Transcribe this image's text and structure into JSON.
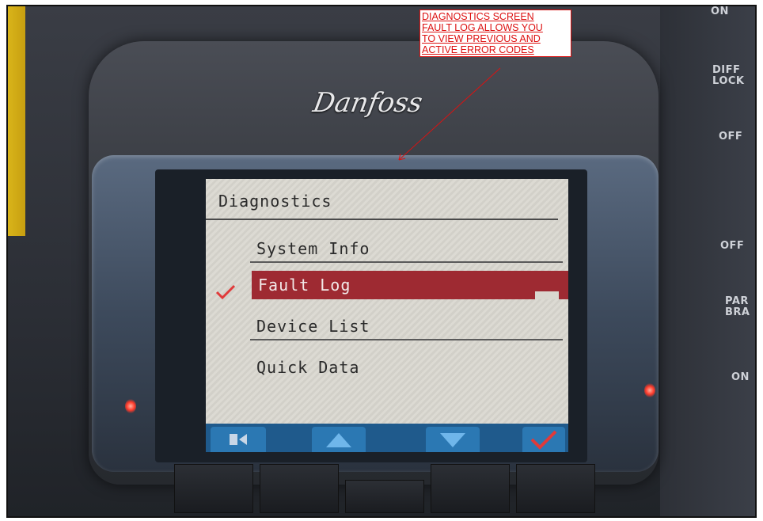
{
  "annotation": {
    "lines": [
      "DIAGNOSTICS SCREEN",
      "FAULT LOG ALLOWS YOU",
      "TO VIEW PREVIOUS AND",
      "ACTIVE ERROR CODES"
    ],
    "color": "#dd1111"
  },
  "brand": {
    "logo_text": "Danfoss"
  },
  "side_labels": {
    "on_top": "ON",
    "diff": "DIFF",
    "lock": "LOCK",
    "off1": "OFF",
    "off2": "OFF",
    "par": "PAR",
    "bra": "BRA",
    "on_bottom": "ON"
  },
  "screen": {
    "title": "Diagnostics",
    "menu_items": [
      {
        "label": "System Info",
        "selected": false
      },
      {
        "label": "Fault Log",
        "selected": true
      },
      {
        "label": "Device List",
        "selected": false
      },
      {
        "label": "Quick Data",
        "selected": false
      }
    ],
    "selection_color": "#9e2a32",
    "checkmark_color": "#e03a3a",
    "softkeys": [
      {
        "icon": "back-exit-icon"
      },
      {
        "icon": "arrow-up-icon"
      },
      {
        "icon": "arrow-down-icon"
      },
      {
        "icon": "confirm-check-icon"
      }
    ],
    "softkey_color": "#2b78b3"
  },
  "status_leds": {
    "left": "on",
    "right": "on",
    "color": "#ff3a2a"
  }
}
